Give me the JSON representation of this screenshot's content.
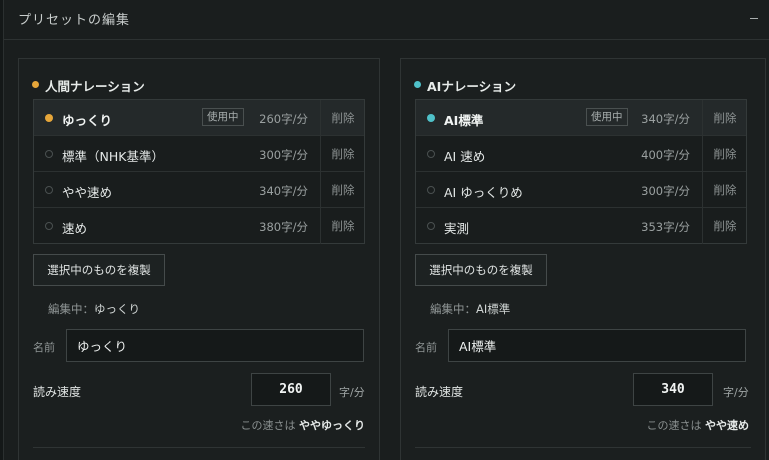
{
  "header": {
    "title": "プリセットの編集",
    "collapse_icon": "minus-icon"
  },
  "colors": {
    "human_accent": "#e6a63a",
    "ai_accent": "#4fc1c9"
  },
  "human": {
    "title": "人間ナレーション",
    "presets": [
      {
        "name": "ゆっくり",
        "rate": "260字/分",
        "badge": "使用中",
        "delete": "削除",
        "selected": true
      },
      {
        "name": "標準（NHK基準）",
        "rate": "300字/分",
        "delete": "削除",
        "selected": false
      },
      {
        "name": "やや速め",
        "rate": "340字/分",
        "delete": "削除",
        "selected": false
      },
      {
        "name": "速め",
        "rate": "380字/分",
        "delete": "削除",
        "selected": false
      }
    ],
    "duplicate_label": "選択中のものを複製",
    "editing_prefix": "編集中：",
    "editing_name": "ゆっくり",
    "name_label": "名前",
    "name_value": "ゆっくり",
    "speed_label": "読み速度",
    "speed_value": "260",
    "unit": "字/分",
    "hint_prefix": "この速さは",
    "hint_value": "ややゆっくり"
  },
  "ai": {
    "title": "AIナレーション",
    "presets": [
      {
        "name": "AI標準",
        "rate": "340字/分",
        "badge": "使用中",
        "delete": "削除",
        "selected": true
      },
      {
        "name": "AI 速め",
        "rate": "400字/分",
        "delete": "削除",
        "selected": false
      },
      {
        "name": "AI ゆっくりめ",
        "rate": "300字/分",
        "delete": "削除",
        "selected": false
      },
      {
        "name": "実測",
        "rate": "353字/分",
        "delete": "削除",
        "selected": false
      }
    ],
    "duplicate_label": "選択中のものを複製",
    "editing_prefix": "編集中：",
    "editing_name": "AI標準",
    "name_label": "名前",
    "name_value": "AI標準",
    "speed_label": "読み速度",
    "speed_value": "340",
    "unit": "字/分",
    "hint_prefix": "この速さは",
    "hint_value": "やや速め"
  }
}
